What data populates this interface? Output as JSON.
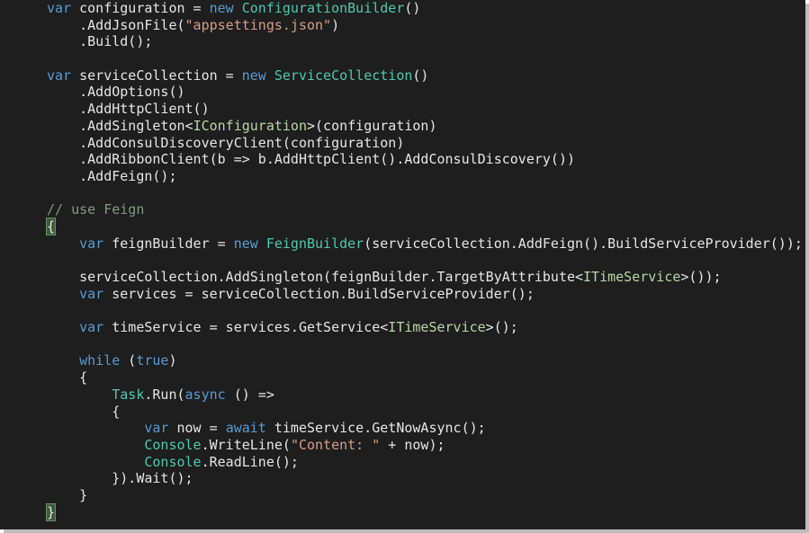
{
  "editor": {
    "background": "#1e1e1e",
    "colors": {
      "keyword": "#569cd6",
      "type": "#4ec9b0",
      "interface": "#b8d7a3",
      "string": "#d69d85",
      "comment": "#7f9b7f",
      "text": "#e6e6e6"
    },
    "lines": [
      [
        {
          "t": "var",
          "k": "kw"
        },
        {
          "t": " configuration = "
        },
        {
          "t": "new",
          "k": "kw"
        },
        {
          "t": " "
        },
        {
          "t": "ConfigurationBuilder",
          "k": "ty"
        },
        {
          "t": "()"
        }
      ],
      [
        {
          "t": "    .AddJsonFile("
        },
        {
          "t": "\"appsettings.json\"",
          "k": "str"
        },
        {
          "t": ")"
        }
      ],
      [
        {
          "t": "    .Build();"
        }
      ],
      [],
      [
        {
          "t": "var",
          "k": "kw"
        },
        {
          "t": " serviceCollection = "
        },
        {
          "t": "new",
          "k": "kw"
        },
        {
          "t": " "
        },
        {
          "t": "ServiceCollection",
          "k": "ty"
        },
        {
          "t": "()"
        }
      ],
      [
        {
          "t": "    .AddOptions()"
        }
      ],
      [
        {
          "t": "    .AddHttpClient()"
        }
      ],
      [
        {
          "t": "    .AddSingleton<"
        },
        {
          "t": "IConfiguration",
          "k": "iface"
        },
        {
          "t": ">(configuration)"
        }
      ],
      [
        {
          "t": "    .AddConsulDiscoveryClient(configuration)"
        }
      ],
      [
        {
          "t": "    .AddRibbonClient(b => b.AddHttpClient().AddConsulDiscovery())"
        }
      ],
      [
        {
          "t": "    .AddFeign();"
        }
      ],
      [],
      [
        {
          "t": "// use Feign",
          "k": "cm"
        }
      ],
      [
        {
          "t": "{",
          "k": "br"
        }
      ],
      [
        {
          "t": "    "
        },
        {
          "t": "var",
          "k": "kw"
        },
        {
          "t": " feignBuilder = "
        },
        {
          "t": "new",
          "k": "kw"
        },
        {
          "t": " "
        },
        {
          "t": "FeignBuilder",
          "k": "ty"
        },
        {
          "t": "(serviceCollection.AddFeign().BuildServiceProvider());"
        }
      ],
      [],
      [
        {
          "t": "    serviceCollection.AddSingleton(feignBuilder.TargetByAttribute<"
        },
        {
          "t": "ITimeService",
          "k": "iface"
        },
        {
          "t": ">());"
        }
      ],
      [
        {
          "t": "    "
        },
        {
          "t": "var",
          "k": "kw"
        },
        {
          "t": " services = serviceCollection.BuildServiceProvider();"
        }
      ],
      [],
      [
        {
          "t": "    "
        },
        {
          "t": "var",
          "k": "kw"
        },
        {
          "t": " timeService = services.GetService<"
        },
        {
          "t": "ITimeService",
          "k": "iface"
        },
        {
          "t": ">();"
        }
      ],
      [],
      [
        {
          "t": "    "
        },
        {
          "t": "while",
          "k": "kw"
        },
        {
          "t": " ("
        },
        {
          "t": "true",
          "k": "kw"
        },
        {
          "t": ")"
        }
      ],
      [
        {
          "t": "    {"
        }
      ],
      [
        {
          "t": "        "
        },
        {
          "t": "Task",
          "k": "ty"
        },
        {
          "t": ".Run("
        },
        {
          "t": "async",
          "k": "kw"
        },
        {
          "t": " () =>"
        }
      ],
      [
        {
          "t": "        {"
        }
      ],
      [
        {
          "t": "            "
        },
        {
          "t": "var",
          "k": "kw"
        },
        {
          "t": " now = "
        },
        {
          "t": "await",
          "k": "kw"
        },
        {
          "t": " timeService.GetNowAsync();"
        }
      ],
      [
        {
          "t": "            "
        },
        {
          "t": "Console",
          "k": "ty"
        },
        {
          "t": ".WriteLine("
        },
        {
          "t": "\"Content: \"",
          "k": "str"
        },
        {
          "t": " + now);"
        }
      ],
      [
        {
          "t": "            "
        },
        {
          "t": "Console",
          "k": "ty"
        },
        {
          "t": ".ReadLine();"
        }
      ],
      [
        {
          "t": "        }).Wait();"
        }
      ],
      [
        {
          "t": "    }"
        }
      ],
      [
        {
          "t": "}",
          "k": "br"
        }
      ]
    ]
  }
}
